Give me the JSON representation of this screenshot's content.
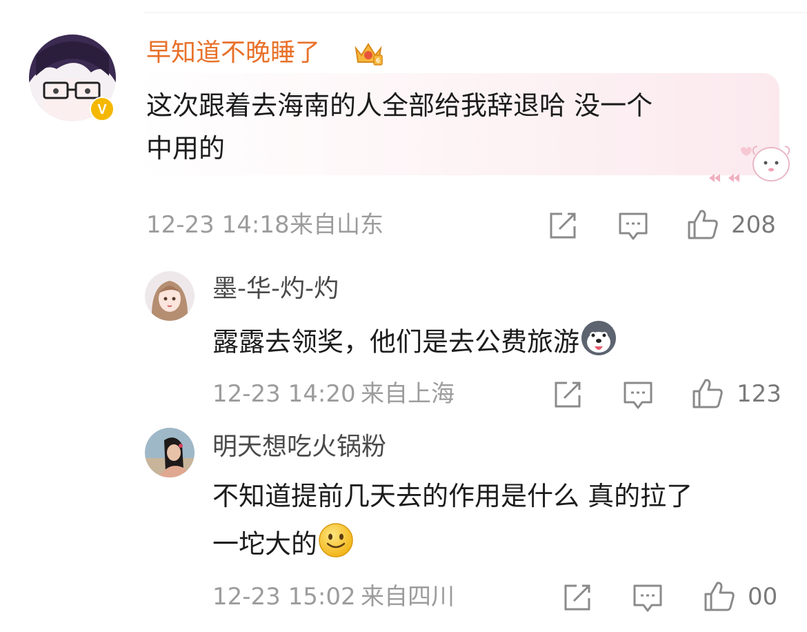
{
  "comment": {
    "username": "早知道不晚睡了",
    "text_line1": "这次跟着去海南的人全部给我辞退哈 没一个",
    "text_line2": "中用的",
    "time": "12-23 14:18",
    "location": "来自山东",
    "likes": "208",
    "verified_badge": "V"
  },
  "replies": [
    {
      "username": "墨-华-灼-灼",
      "text": "露露去领奖，他们是去公费旅游",
      "emoji": "husky-emoji",
      "time": "12-23 14:20",
      "location": "来自上海",
      "likes": "123"
    },
    {
      "username": "明天想吃火锅粉",
      "text_line1": "不知道提前几天去的作用是什么 真的拉了",
      "text_line2": "一坨大的",
      "emoji": "smile-emoji",
      "time": "12-23 15:02",
      "location": "来自四川",
      "likes": "00"
    }
  ],
  "icons": [
    "share-icon",
    "comment-icon",
    "like-icon",
    "crown-badge-icon",
    "verified-v-icon"
  ],
  "colors": {
    "username_accent": "#e8712a",
    "meta_gray": "#9c9c9c",
    "verified_yellow": "#f5b800"
  }
}
